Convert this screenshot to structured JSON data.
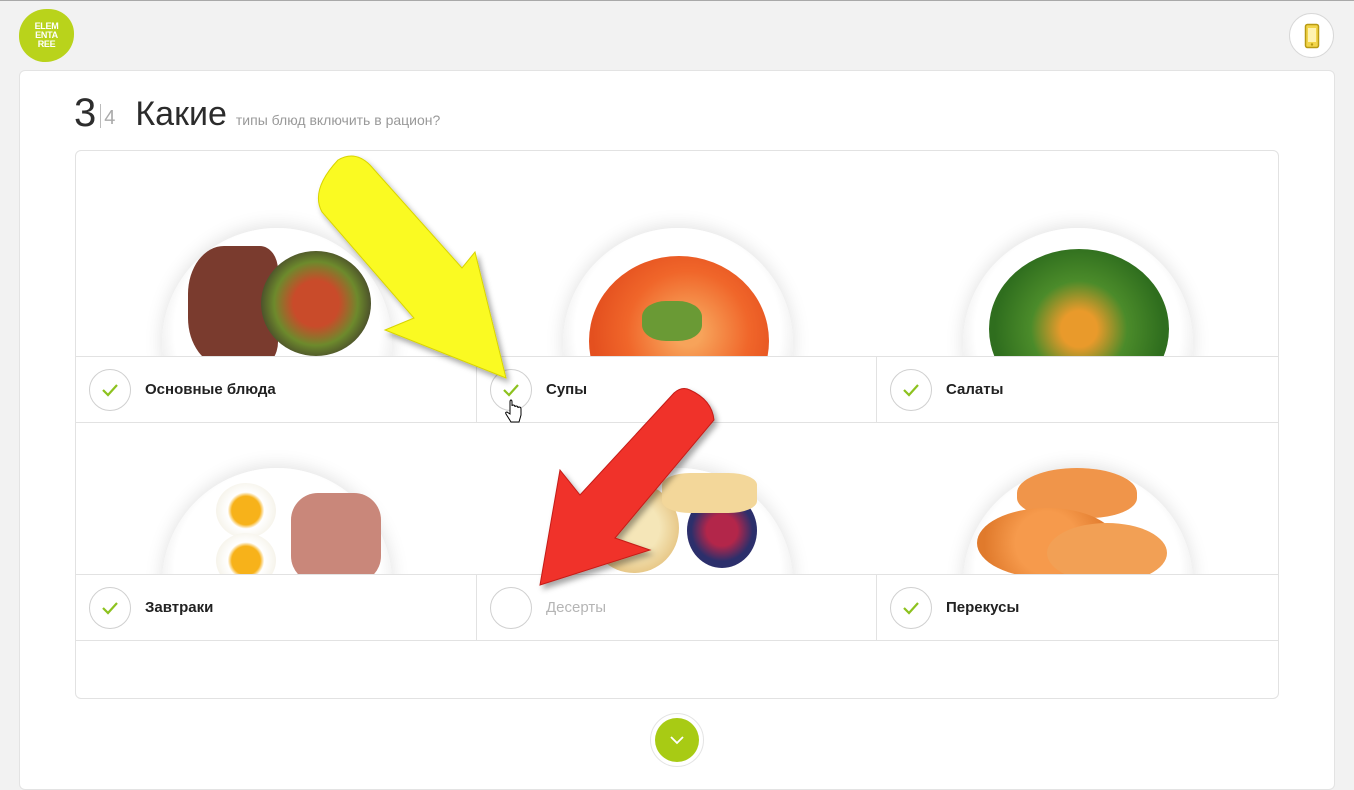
{
  "header": {
    "logo_lines": [
      "ELEM",
      "ENTA",
      "REE"
    ],
    "phone_icon": "phone-icon"
  },
  "step": {
    "current": "3",
    "total": "4"
  },
  "title": {
    "main": "Какие",
    "sub": "типы блюд включить в рацион?"
  },
  "categories": [
    {
      "label": "Основные блюда",
      "checked": true,
      "image": "steak-plate"
    },
    {
      "label": "Супы",
      "checked": true,
      "image": "soup-plate"
    },
    {
      "label": "Салаты",
      "checked": true,
      "image": "salad-plate"
    },
    {
      "label": "Завтраки",
      "checked": true,
      "image": "breakfast-plate"
    },
    {
      "label": "Десерты",
      "checked": false,
      "image": "dessert-plate"
    },
    {
      "label": "Перекусы",
      "checked": true,
      "image": "melon-plate"
    }
  ],
  "colors": {
    "accent": "#a8cb14",
    "check": "#8dc21f",
    "logo": "#b9d31b"
  },
  "next_icon": "chevron-down-icon"
}
